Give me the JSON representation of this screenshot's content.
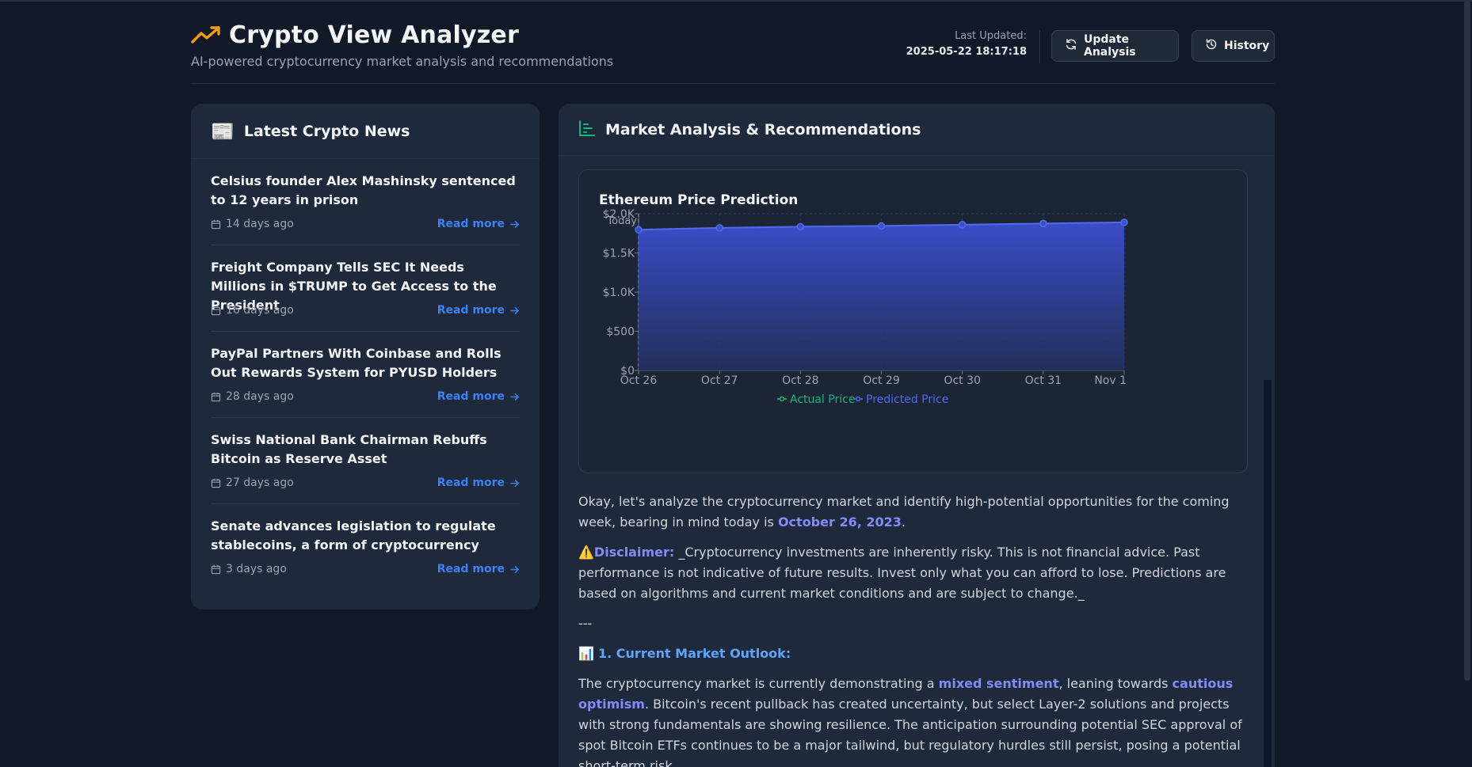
{
  "header": {
    "title": "Crypto View Analyzer",
    "subtitle": "AI-powered cryptocurrency market analysis and recommendations",
    "last_updated_label": "Last Updated:",
    "last_updated_value": "2025-05-22 18:17:18",
    "update_button": "Update Analysis",
    "history_button": "History"
  },
  "news": {
    "heading": "Latest Crypto News",
    "items": [
      {
        "title": "Celsius founder Alex Mashinsky sentenced to 12 years in prison",
        "date": "14 days ago",
        "link": "Read more"
      },
      {
        "title": "Freight Company Tells SEC It Needs Millions in $TRUMP to Get Access to the President",
        "date": "16 days ago",
        "link": "Read more"
      },
      {
        "title": "PayPal Partners With Coinbase and Rolls Out Rewards System for PYUSD Holders",
        "date": "28 days ago",
        "link": "Read more"
      },
      {
        "title": "Swiss National Bank Chairman Rebuffs Bitcoin as Reserve Asset",
        "date": "27 days ago",
        "link": "Read more"
      },
      {
        "title": "Senate advances legislation to regulate stablecoins, a form of cryptocurrency",
        "date": "3 days ago",
        "link": "Read more"
      }
    ]
  },
  "analysis": {
    "heading": "Market Analysis & Recommendations",
    "intro_1": "Okay, let's analyze the cryptocurrency market and identify high-potential opportunities for the coming week, bearing in mind today is ",
    "intro_date": "October 26, 2023",
    "intro_end": ".",
    "disclaimer_label": "Disclaimer:",
    "disclaimer_text": " _Cryptocurrency investments are inherently risky. This is not financial advice. Past performance is not indicative of future results. Invest only what you can afford to lose. Predictions are based on algorithms and current market conditions and are subject to change._",
    "separator": "---",
    "section_1": "1. Current Market Outlook:",
    "outlook_1": "The cryptocurrency market is currently demonstrating a ",
    "outlook_hl1": "mixed sentiment",
    "outlook_2": ", leaning towards ",
    "outlook_hl2": "cautious optimism",
    "outlook_3": ". Bitcoin's recent pullback has created uncertainty, but select Layer-2 solutions and projects with strong fundamentals are showing resilience. The anticipation surrounding potential SEC approval of spot Bitcoin ETFs continues to be a major tailwind, but regulatory hurdles still persist, posing a potential short-term risk."
  },
  "chart_data": {
    "type": "area",
    "title": "Ethereum Price Prediction",
    "categories": [
      "Oct 26",
      "Oct 27",
      "Oct 28",
      "Oct 29",
      "Oct 30",
      "Oct 31",
      "Nov 1"
    ],
    "series": [
      {
        "name": "Actual Price",
        "values": [],
        "color": "#10b981"
      },
      {
        "name": "Predicted Price",
        "values": [
          1795,
          1820,
          1835,
          1845,
          1860,
          1875,
          1890
        ],
        "color": "#4f6bed"
      }
    ],
    "y_ticks": [
      "$0",
      "$500",
      "$1.0K",
      "$1.5K",
      "$2.0K"
    ],
    "ylim": [
      0,
      2000
    ],
    "reference_label": "Today",
    "legend": "bottom",
    "grid": true
  },
  "colors": {
    "background": "#111827",
    "panel": "#1e293b",
    "accent": "#3b82f6",
    "trend_icon": "#f59e0b",
    "chart_icon": "#10b981"
  },
  "icons": {
    "title": "trending-up-icon",
    "update": "refresh-icon",
    "history": "history-icon",
    "news": "newspaper-icon",
    "analysis": "bar-chart-icon",
    "date": "calendar-icon",
    "read_more": "arrow-right-icon"
  }
}
